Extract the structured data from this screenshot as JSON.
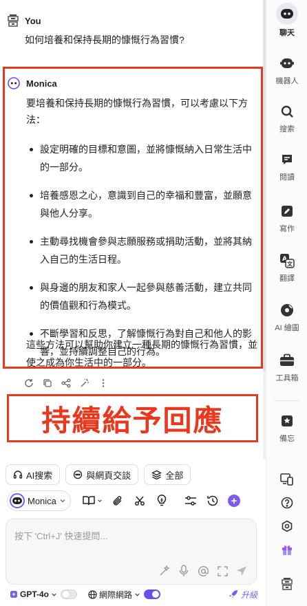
{
  "conversation": {
    "user": {
      "name": "You",
      "message": "如何培養和保持長期的慷慨行為習慣?"
    },
    "assistant": {
      "name": "Monica",
      "intro": "要培養和保持長期的慷慨行為習慣，可以考慮以下方法：",
      "points": [
        "設定明確的目標和意圖，並將慷慨納入日常生活中的一部分。",
        "培養感恩之心，意識到自己的幸福和豐富，並願意與他人分享。",
        "主動尋找機會參與志願服務或捐助活動，並將其納入自己的生活日程。",
        "與身邊的朋友和家人一起參與慈善活動，建立共同的價值觀和行為模式。",
        "不斷學習和反思，了解慷慨行為對自己和他人的影響，並持續調整自己的行為。"
      ],
      "outro": "這些方法可以幫助你建立一種長期的慷慨行為習慣，並使之成為你生活中的一部分。"
    },
    "banner": "持續給予回應"
  },
  "quick_actions": [
    {
      "label": "AI搜索",
      "icon": "headset-icon"
    },
    {
      "label": "與網頁交談",
      "icon": "chat-bubble-icon"
    },
    {
      "label": "全部",
      "icon": "layers-icon"
    }
  ],
  "toolbar": {
    "model_name": "Monica"
  },
  "input": {
    "placeholder": "按下 'Ctrl+J' 快速提問..."
  },
  "bottom_bar": {
    "model": "GPT-4o",
    "web_search": "網際網路",
    "upgrade": "升級"
  },
  "sidebar": {
    "items": [
      {
        "label": "聊天",
        "icon": "chat-robot-icon",
        "active": true
      },
      {
        "label": "機器人",
        "icon": "bot-icon"
      },
      {
        "label": "搜索",
        "icon": "search-icon"
      },
      {
        "label": "閱讀",
        "icon": "read-icon"
      },
      {
        "label": "寫作",
        "icon": "pencil-icon"
      },
      {
        "label": "翻譯",
        "icon": "translate-icon"
      },
      {
        "label": "AI 繪圖",
        "icon": "palette-icon"
      },
      {
        "label": "工具箱",
        "icon": "toolbox-icon"
      },
      {
        "label": "備忘",
        "icon": "memo-icon"
      }
    ]
  },
  "colors": {
    "accent": "#7e5bef",
    "highlight_border": "#e8381e"
  }
}
